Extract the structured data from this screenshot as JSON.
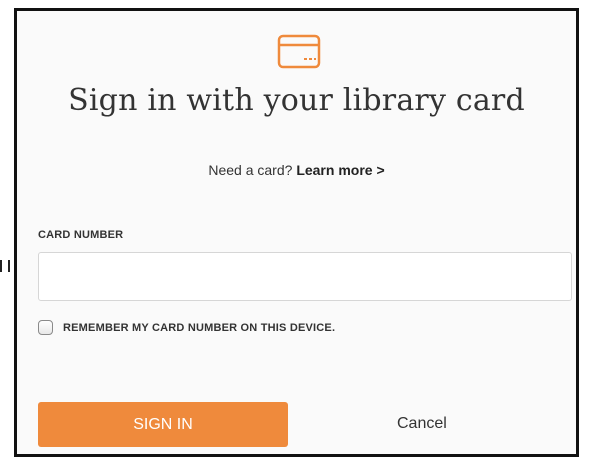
{
  "dialog": {
    "title": "Sign in with your library card",
    "help_text": "Need a card?",
    "learn_more_link": "Learn more >",
    "card_number_label": "CARD NUMBER",
    "card_number_value": "",
    "card_number_placeholder": "",
    "remember_label": "REMEMBER MY CARD NUMBER ON THIS DEVICE.",
    "remember_checked": false,
    "sign_in_label": "SIGN IN",
    "cancel_label": "Cancel"
  },
  "icons": {
    "header": "credit-card-icon"
  },
  "colors": {
    "accent": "#ef8a3c",
    "text": "#333333",
    "border": "#111111",
    "background": "#fafafa"
  }
}
